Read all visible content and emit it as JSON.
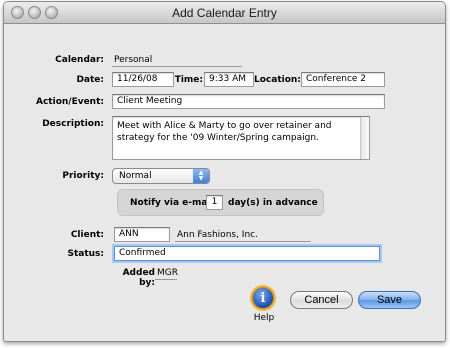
{
  "window": {
    "title": "Add Calendar Entry"
  },
  "form": {
    "calendar_label": "Calendar:",
    "calendar_value": "Personal",
    "date_label": "Date:",
    "date_value": "11/26/08",
    "time_label": "Time:",
    "time_value": "9:33 AM",
    "location_label": "Location:",
    "location_value": "Conference 2",
    "action_label": "Action/Event:",
    "action_value": "Client Meeting",
    "description_label": "Description:",
    "description_value": "Meet with Alice & Marty to go over retainer and strategy for the '09 Winter/Spring campaign.",
    "priority_label": "Priority:",
    "priority_value": "Normal",
    "notify_prefix": "Notify via e-mail",
    "notify_days": "1",
    "notify_suffix": "day(s) in advance",
    "client_label": "Client:",
    "client_code": "ANN",
    "client_name": "Ann Fashions, Inc.",
    "status_label": "Status:",
    "status_value": "Confirmed",
    "added_by_label": "Added by:",
    "added_by_value": "MGR"
  },
  "buttons": {
    "help_label": "Help",
    "help_glyph": "i",
    "cancel_label": "Cancel",
    "save_label": "Save"
  },
  "colors": {
    "default_button": "#5a97e6",
    "focus_ring": "#a8c7f2"
  }
}
